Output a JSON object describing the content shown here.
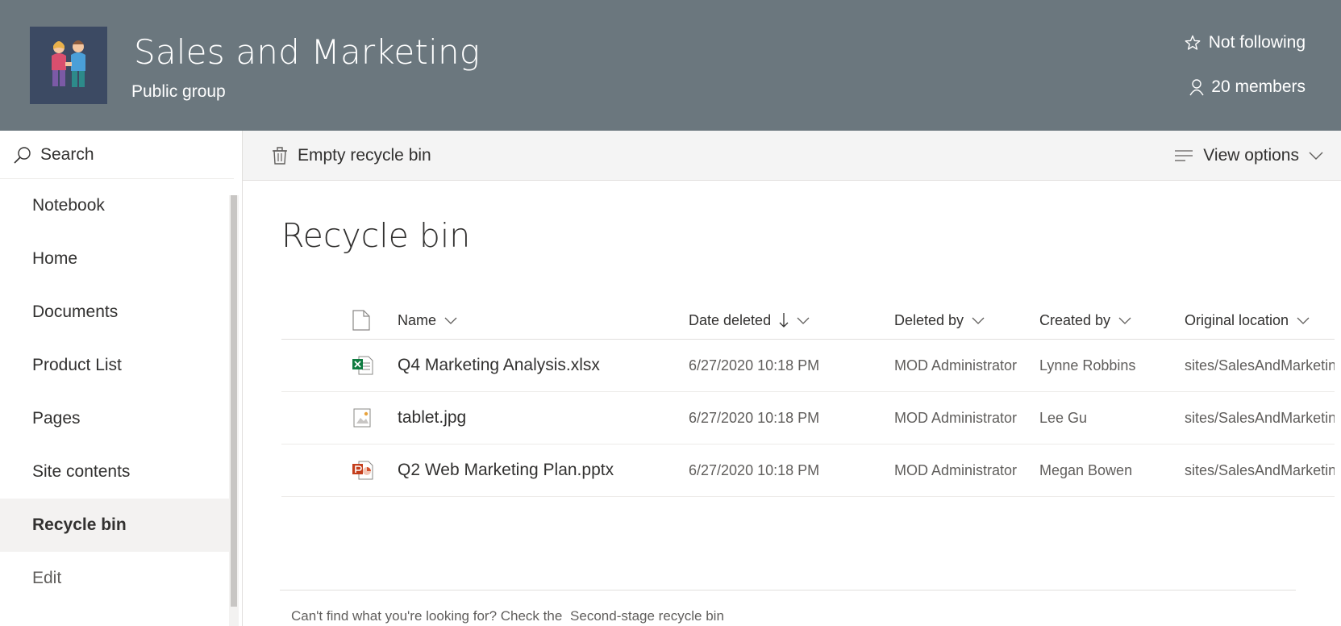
{
  "header": {
    "site_title": "Sales and Marketing",
    "site_subtitle": "Public group",
    "follow_label": "Not following",
    "members_label": "20 members",
    "bg_color": "#6b777e",
    "logo_color": "#3c4a63"
  },
  "leftnav": {
    "search_label": "Search",
    "items": [
      {
        "label": "Notebook"
      },
      {
        "label": "Home"
      },
      {
        "label": "Documents"
      },
      {
        "label": "Product List"
      },
      {
        "label": "Pages"
      },
      {
        "label": "Site contents"
      },
      {
        "label": "Recycle bin",
        "active": true
      },
      {
        "label": "Edit"
      }
    ]
  },
  "commandbar": {
    "empty_label": "Empty recycle bin",
    "view_options_label": "View options"
  },
  "main": {
    "title": "Recycle bin",
    "columns": {
      "name": "Name",
      "date_deleted": "Date deleted",
      "deleted_by": "Deleted by",
      "created_by": "Created by",
      "original_location": "Original location"
    },
    "rows": [
      {
        "icon": "excel-file-icon",
        "name": "Q4 Marketing Analysis.xlsx",
        "date_deleted": "6/27/2020 10:18 PM",
        "deleted_by": "MOD Administrator",
        "created_by": "Lynne Robbins",
        "original_location": "sites/SalesAndMarketin"
      },
      {
        "icon": "image-file-icon",
        "name": "tablet.jpg",
        "date_deleted": "6/27/2020 10:18 PM",
        "deleted_by": "MOD Administrator",
        "created_by": "Lee Gu",
        "original_location": "sites/SalesAndMarketin"
      },
      {
        "icon": "powerpoint-file-icon",
        "name": "Q2 Web Marketing Plan.pptx",
        "date_deleted": "6/27/2020 10:18 PM",
        "deleted_by": "MOD Administrator",
        "created_by": "Megan Bowen",
        "original_location": "sites/SalesAndMarketin"
      }
    ],
    "footer_text": "Can't find what you're looking for? Check the",
    "footer_link": "Second-stage recycle bin"
  }
}
